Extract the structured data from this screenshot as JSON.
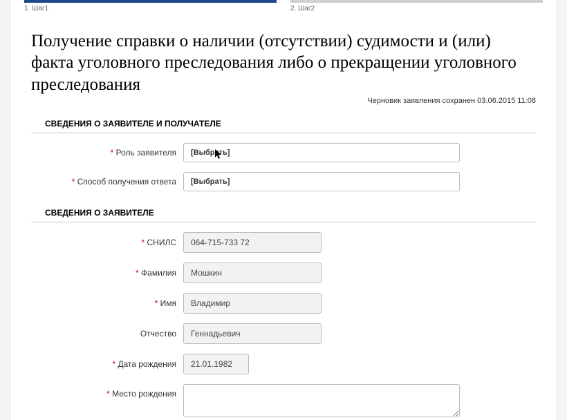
{
  "stepper": {
    "steps": [
      {
        "label": "1. Шаг1",
        "active": true
      },
      {
        "label": "2. Шаг2",
        "active": false
      }
    ]
  },
  "title": "Получение справки о наличии (отсутствии) судимости и (или) факта уголовного преследования либо о прекращении уголовного преследования",
  "draft_saved": "Черновик заявления сохранен 03.06.2015 11:08",
  "section1": {
    "title": "СВЕДЕНИЯ О ЗАЯВИТЕЛЕ И ПОЛУЧАТЕЛЕ",
    "role_label": "Роль заявителя",
    "role_value": "[Выбрать]",
    "delivery_label": "Способ получения ответа",
    "delivery_value": "[Выбрать]"
  },
  "section2": {
    "title": "СВЕДЕНИЯ О ЗАЯВИТЕЛЕ",
    "snils_label": "СНИЛС",
    "snils_value": "064-715-733 72",
    "surname_label": "Фамилия",
    "surname_value": "Мошкин",
    "name_label": "Имя",
    "name_value": "Владимир",
    "patronymic_label": "Отчество",
    "patronymic_value": "Геннадьевич",
    "dob_label": "Дата рождения",
    "dob_value": "21.01.1982",
    "birthplace_label": "Место рождения",
    "birthplace_value": ""
  },
  "required_mark": "*"
}
